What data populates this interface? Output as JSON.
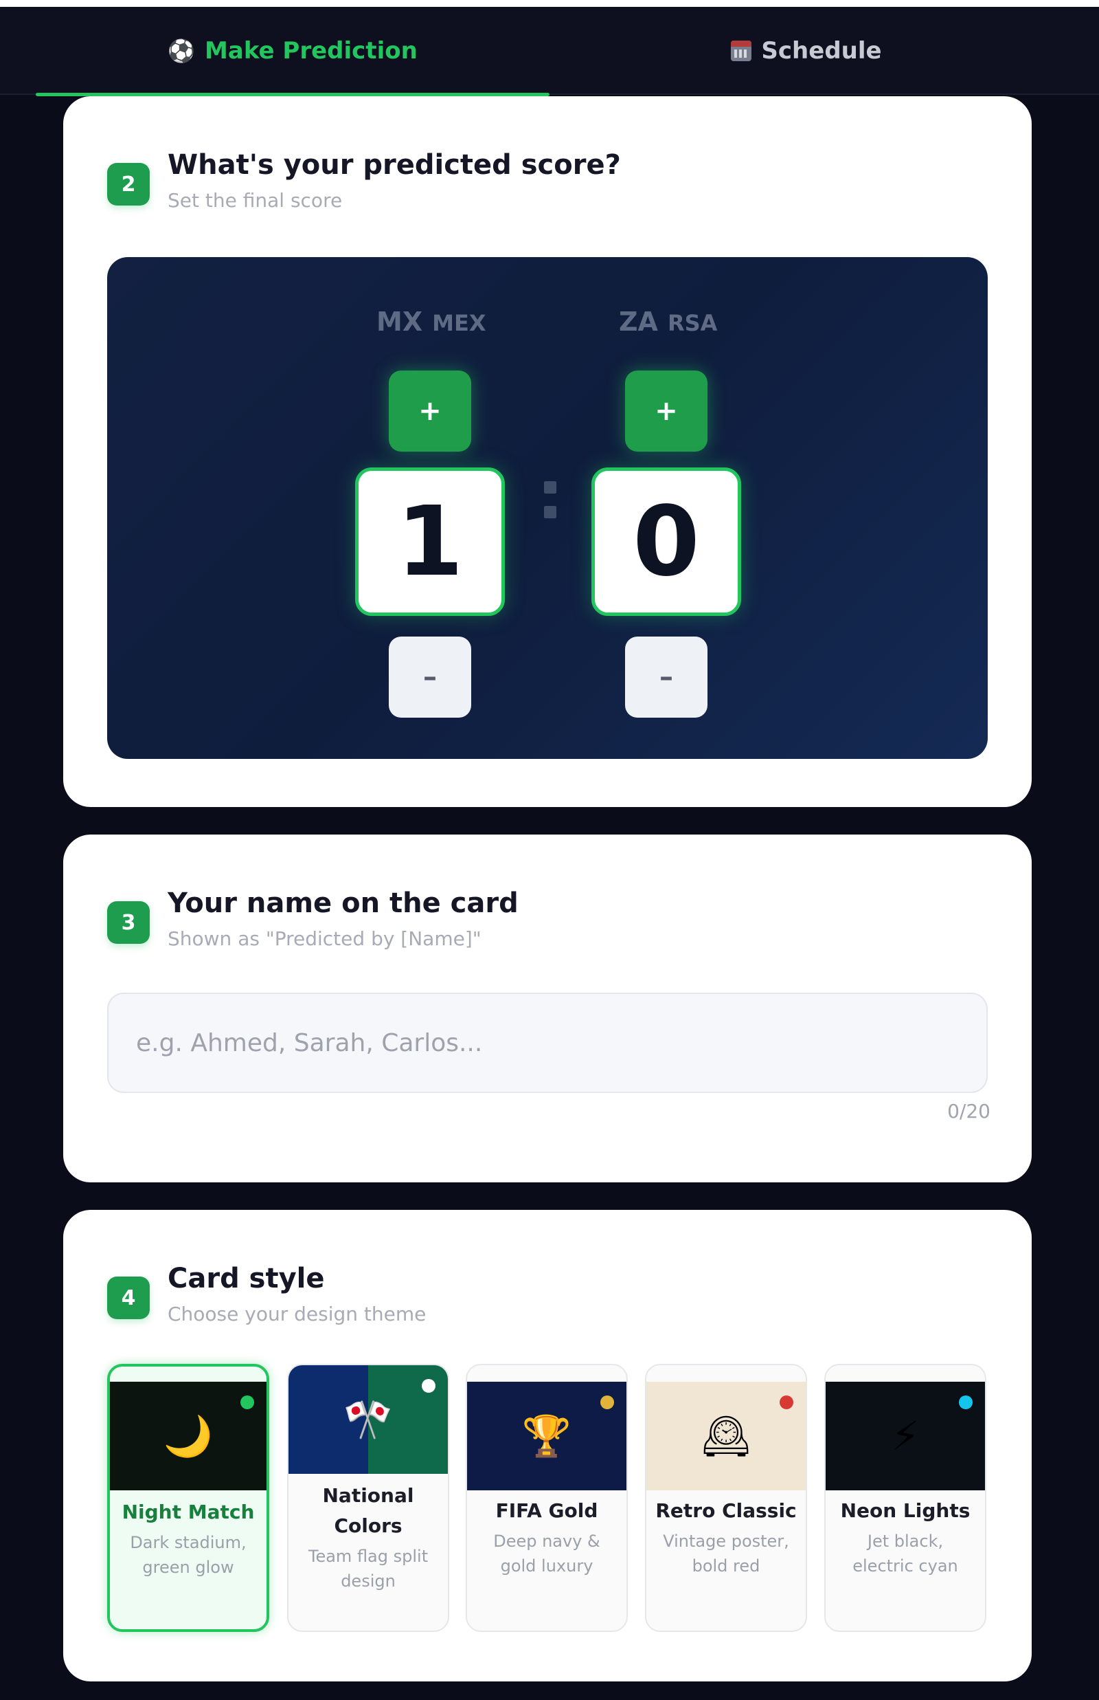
{
  "tabs": [
    {
      "label": "Make Prediction",
      "icon": "soccer-ball-icon",
      "active": true
    },
    {
      "label": "Schedule",
      "icon": "calendar-icon",
      "active": false
    }
  ],
  "step2": {
    "number": "2",
    "title": "What's your predicted score?",
    "subtitle": "Set the final score",
    "home": {
      "flag": "MX",
      "code": "MEX",
      "score": "1"
    },
    "away": {
      "flag": "ZA",
      "code": "RSA",
      "score": "0"
    },
    "plus_label": "+",
    "minus_label": "–",
    "colors": {
      "accent": "#22c55e",
      "panel": "#122142"
    }
  },
  "step3": {
    "number": "3",
    "title": "Your name on the card",
    "subtitle": "Shown as \"Predicted by [Name]\"",
    "input": {
      "value": "",
      "placeholder": "e.g. Ahmed, Sarah, Carlos..."
    },
    "counter": "0/20"
  },
  "step4": {
    "number": "4",
    "title": "Card style",
    "subtitle": "Choose your design theme",
    "styles": [
      {
        "name": "Night Match",
        "desc": "Dark stadium, green glow",
        "icon": "crescent-moon-icon",
        "glyph": "🌙",
        "dot": "#22c55e",
        "selected": true
      },
      {
        "name": "National Colors",
        "desc": "Team flag split design",
        "icon": "crossed-flags-icon",
        "glyph": "🎌",
        "dot": "#ffffff",
        "selected": false
      },
      {
        "name": "FIFA Gold",
        "desc": "Deep navy & gold luxury",
        "icon": "trophy-icon",
        "glyph": "🏆",
        "dot": "#e0b43a",
        "selected": false
      },
      {
        "name": "Retro Classic",
        "desc": "Vintage poster, bold red",
        "icon": "mantelpiece-clock-icon",
        "glyph": "🕰",
        "dot": "#d63a32",
        "selected": false
      },
      {
        "name": "Neon Lights",
        "desc": "Jet black, electric cyan",
        "icon": "lightning-icon",
        "glyph": "⚡",
        "dot": "#14c6ee",
        "selected": false
      }
    ]
  }
}
